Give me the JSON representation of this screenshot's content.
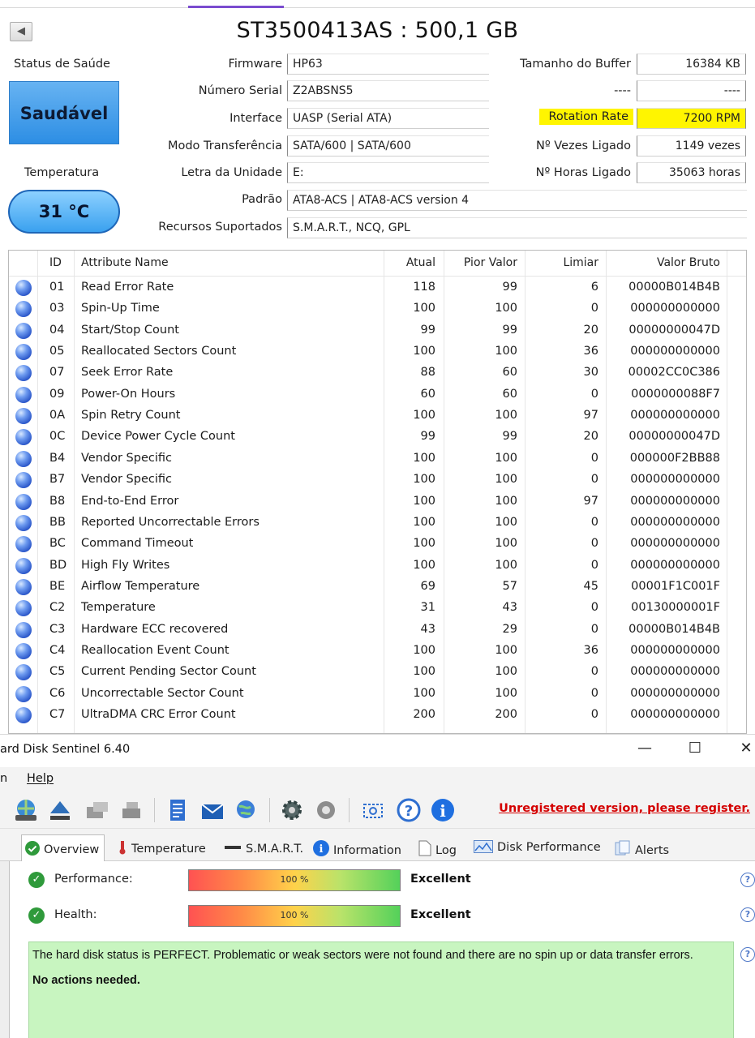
{
  "crystal": {
    "disk_title": "ST3500413AS : 500,1 GB",
    "health_label": "Status de Saúde",
    "health_value": "Saudável",
    "temp_label": "Temperatura",
    "temp_value": "31 °C",
    "fields": {
      "firmware": {
        "label": "Firmware",
        "value": "HP63"
      },
      "serial": {
        "label": "Número Serial",
        "value": "Z2ABSNS5"
      },
      "interface": {
        "label": "Interface",
        "value": "UASP (Serial ATA)"
      },
      "transfer": {
        "label": "Modo Transferência",
        "value": "SATA/600 | SATA/600"
      },
      "drive_letter": {
        "label": "Letra da Unidade",
        "value": "E:"
      },
      "standard": {
        "label": "Padrão",
        "value": "ATA8-ACS | ATA8-ACS version 4"
      },
      "features": {
        "label": "Recursos Suportados",
        "value": "S.M.A.R.T., NCQ, GPL"
      },
      "buffer": {
        "label": "Tamanho do Buffer",
        "value": "16384 KB"
      },
      "blank": {
        "label": "----",
        "value": "----"
      },
      "rotation": {
        "label": "Rotation Rate",
        "value": "7200 RPM"
      },
      "power_count": {
        "label": "Nº Vezes Ligado",
        "value": "1149 vezes"
      },
      "power_hours": {
        "label": "Nº Horas Ligado",
        "value": "35063 horas"
      }
    },
    "smart_headers": {
      "id": "ID",
      "name": "Attribute Name",
      "current": "Atual",
      "worst": "Pior Valor",
      "threshold": "Limiar",
      "raw": "Valor Bruto"
    },
    "smart_rows": [
      {
        "id": "01",
        "name": "Read Error Rate",
        "current": "118",
        "worst": "99",
        "threshold": "6",
        "raw": "00000B014B4B"
      },
      {
        "id": "03",
        "name": "Spin-Up Time",
        "current": "100",
        "worst": "100",
        "threshold": "0",
        "raw": "000000000000"
      },
      {
        "id": "04",
        "name": "Start/Stop Count",
        "current": "99",
        "worst": "99",
        "threshold": "20",
        "raw": "00000000047D"
      },
      {
        "id": "05",
        "name": "Reallocated Sectors Count",
        "current": "100",
        "worst": "100",
        "threshold": "36",
        "raw": "000000000000"
      },
      {
        "id": "07",
        "name": "Seek Error Rate",
        "current": "88",
        "worst": "60",
        "threshold": "30",
        "raw": "00002CC0C386"
      },
      {
        "id": "09",
        "name": "Power-On Hours",
        "current": "60",
        "worst": "60",
        "threshold": "0",
        "raw": "0000000088F7"
      },
      {
        "id": "0A",
        "name": "Spin Retry Count",
        "current": "100",
        "worst": "100",
        "threshold": "97",
        "raw": "000000000000"
      },
      {
        "id": "0C",
        "name": "Device Power Cycle Count",
        "current": "99",
        "worst": "99",
        "threshold": "20",
        "raw": "00000000047D"
      },
      {
        "id": "B4",
        "name": "Vendor Specific",
        "current": "100",
        "worst": "100",
        "threshold": "0",
        "raw": "000000F2BB88"
      },
      {
        "id": "B7",
        "name": "Vendor Specific",
        "current": "100",
        "worst": "100",
        "threshold": "0",
        "raw": "000000000000"
      },
      {
        "id": "B8",
        "name": "End-to-End Error",
        "current": "100",
        "worst": "100",
        "threshold": "97",
        "raw": "000000000000"
      },
      {
        "id": "BB",
        "name": "Reported Uncorrectable Errors",
        "current": "100",
        "worst": "100",
        "threshold": "0",
        "raw": "000000000000"
      },
      {
        "id": "BC",
        "name": "Command Timeout",
        "current": "100",
        "worst": "100",
        "threshold": "0",
        "raw": "000000000000"
      },
      {
        "id": "BD",
        "name": "High Fly Writes",
        "current": "100",
        "worst": "100",
        "threshold": "0",
        "raw": "000000000000"
      },
      {
        "id": "BE",
        "name": "Airflow Temperature",
        "current": "69",
        "worst": "57",
        "threshold": "45",
        "raw": "00001F1C001F"
      },
      {
        "id": "C2",
        "name": "Temperature",
        "current": "31",
        "worst": "43",
        "threshold": "0",
        "raw": "00130000001F"
      },
      {
        "id": "C3",
        "name": "Hardware ECC recovered",
        "current": "43",
        "worst": "29",
        "threshold": "0",
        "raw": "00000B014B4B"
      },
      {
        "id": "C4",
        "name": "Reallocation Event Count",
        "current": "100",
        "worst": "100",
        "threshold": "36",
        "raw": "000000000000"
      },
      {
        "id": "C5",
        "name": "Current Pending Sector Count",
        "current": "100",
        "worst": "100",
        "threshold": "0",
        "raw": "000000000000"
      },
      {
        "id": "C6",
        "name": "Uncorrectable Sector Count",
        "current": "100",
        "worst": "100",
        "threshold": "0",
        "raw": "000000000000"
      },
      {
        "id": "C7",
        "name": "UltraDMA CRC Error Count",
        "current": "200",
        "worst": "200",
        "threshold": "0",
        "raw": "000000000000"
      }
    ]
  },
  "sentinel": {
    "window_title": "ard Disk Sentinel 6.40",
    "menu": {
      "first": "n",
      "help": "Help"
    },
    "unregistered": "Unregistered version, please register.",
    "tabs": {
      "overview": "Overview",
      "temperature": "Temperature",
      "smart": "S.M.A.R.T.",
      "information": "Information",
      "log": "Log",
      "performance": "Disk Performance",
      "alerts": "Alerts"
    },
    "performance": {
      "label": "Performance:",
      "percent_text": "100 %",
      "percent": 100,
      "verdict": "Excellent"
    },
    "health": {
      "label": "Health:",
      "percent_text": "100 %",
      "percent": 100,
      "verdict": "Excellent"
    },
    "status_text": "The hard disk status is PERFECT. Problematic or weak sectors were not found and there are no spin up or data transfer errors.",
    "action_text": "No actions needed.",
    "colors": {
      "highlight": "#fff500",
      "status_bg": "#c8f5c0",
      "unregistered": "#d40000"
    }
  }
}
